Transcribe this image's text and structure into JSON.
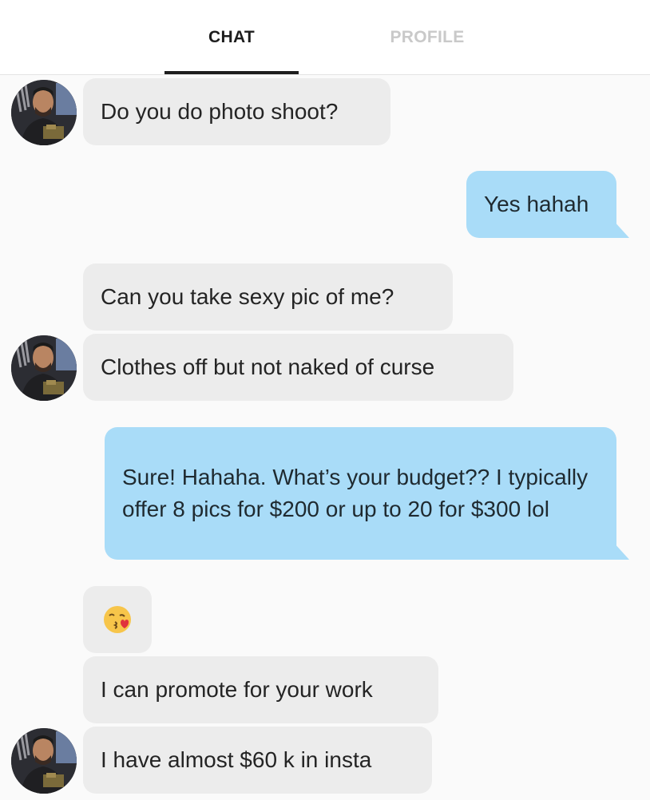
{
  "tabs": {
    "chat": "CHAT",
    "profile": "PROFILE"
  },
  "messages": [
    {
      "from": "them",
      "text": "Do you do photo shoot?"
    },
    {
      "from": "me",
      "text": "Yes hahah"
    },
    {
      "from": "them",
      "text": "Can you take sexy pic of me?"
    },
    {
      "from": "them",
      "text": "Clothes off but not naked of curse"
    },
    {
      "from": "me",
      "text": "Sure! Hahaha. What’s your budget?? I typically offer 8 pics for $200 or up to 20 for $300 lol"
    },
    {
      "from": "them",
      "emoji": "face-blowing-a-kiss"
    },
    {
      "from": "them",
      "text": "I can promote for your work"
    },
    {
      "from": "them",
      "text": "I have almost $60 k in insta"
    }
  ],
  "colors": {
    "incoming_bubble": "#ececec",
    "outgoing_bubble": "#a9dcf8",
    "active_tab": "#1d1d1d",
    "inactive_tab": "#c9c9c9"
  }
}
